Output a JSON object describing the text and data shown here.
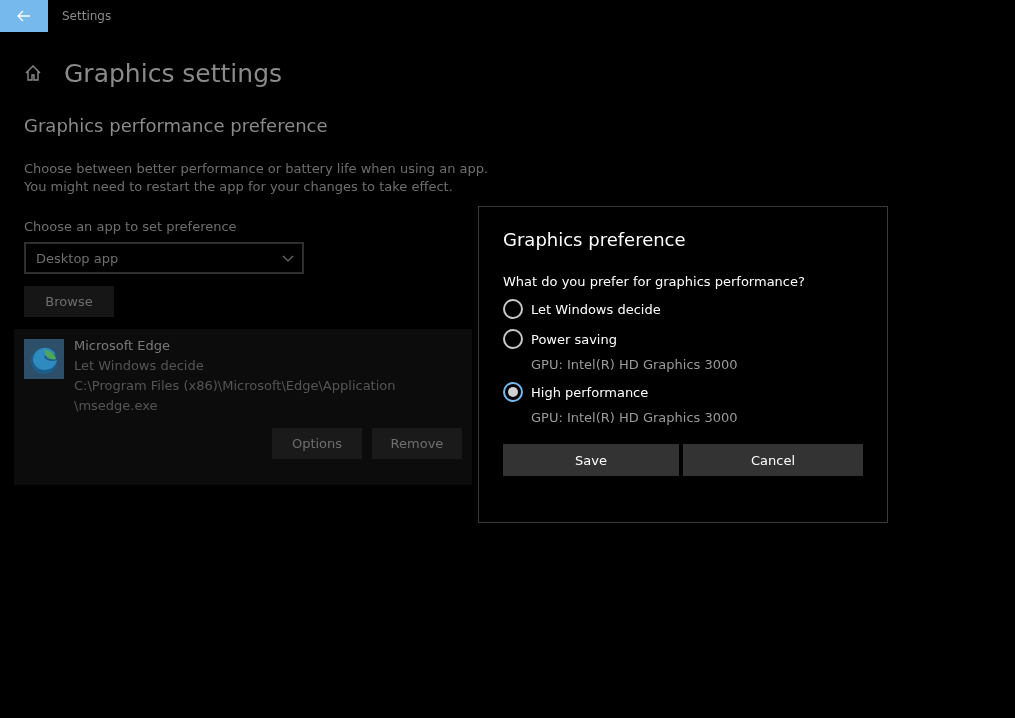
{
  "window": {
    "title": "Settings"
  },
  "page": {
    "title": "Graphics settings",
    "section_title": "Graphics performance preference",
    "description": [
      "Choose between better performance or battery life when using an app.",
      "You might need to restart the app for your changes to take effect."
    ],
    "app_type_label": "Choose an app to set preference",
    "app_type": {
      "value": "Desktop app"
    },
    "browse_button": "Browse"
  },
  "apps": [
    {
      "name": "Microsoft Edge",
      "preference": "Let Windows decide",
      "path": [
        "C:\\Program Files (x86)\\Microsoft\\Edge\\Application",
        "\\msedge.exe"
      ],
      "buttons": [
        "Options",
        "Remove"
      ]
    }
  ],
  "dialog": {
    "title": "Graphics preference",
    "question": "What do you prefer for graphics performance?",
    "options": [
      {
        "label": "Let Windows decide",
        "selected": false
      },
      {
        "label": "Power saving",
        "selected": false,
        "detail": "GPU: Intel(R) HD Graphics 3000"
      },
      {
        "label": "High performance",
        "selected": true,
        "detail": "GPU: Intel(R) HD Graphics 3000"
      }
    ],
    "buttons": [
      "Save",
      "Cancel"
    ]
  }
}
